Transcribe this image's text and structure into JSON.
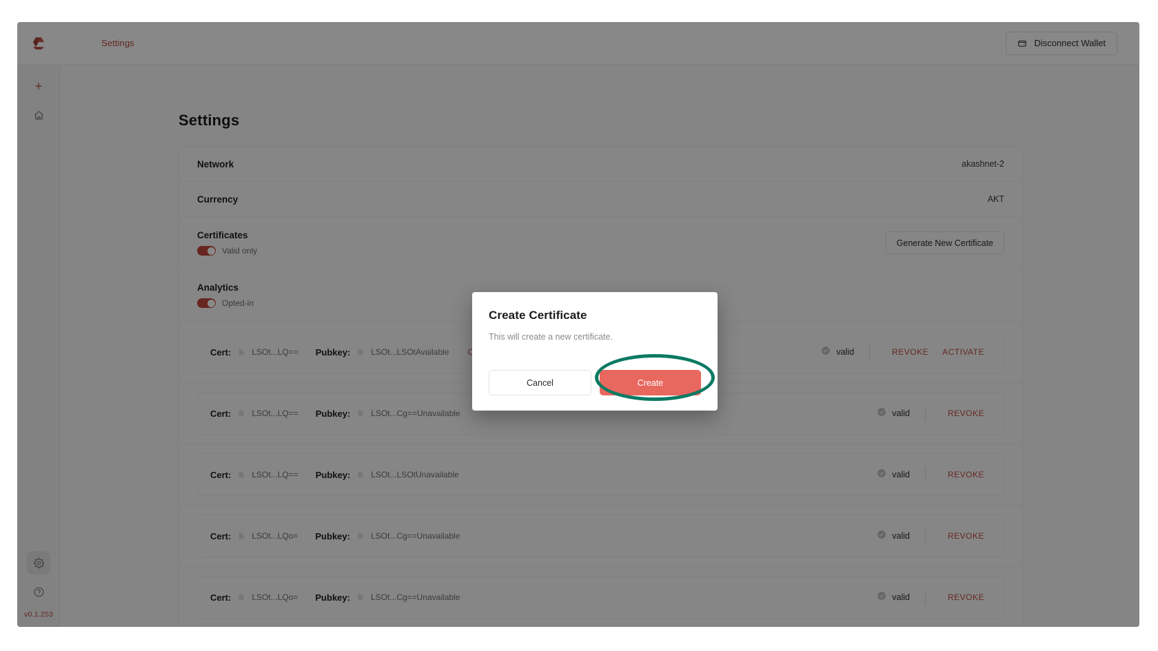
{
  "topbar": {
    "logo_icon": "akash-logo-icon",
    "nav_label": "Settings",
    "wallet_button_label": "Disconnect Wallet",
    "wallet_icon": "wallet-icon"
  },
  "rail": {
    "add_icon": "plus-icon",
    "home_icon": "home-icon",
    "settings_icon": "gear-icon",
    "help_icon": "question-circle-icon",
    "version": "v0.1.253"
  },
  "page": {
    "title": "Settings"
  },
  "settings": {
    "network": {
      "label": "Network",
      "value": "akashnet-2"
    },
    "currency": {
      "label": "Currency",
      "value": "AKT"
    },
    "certificates": {
      "label": "Certificates",
      "toggle_label": "Valid only",
      "toggle_on": true,
      "button_label": "Generate New Certificate"
    },
    "analytics": {
      "label": "Analytics",
      "toggle_label": "Opted-in",
      "toggle_on": true
    }
  },
  "cert_list": {
    "cert_key_label": "Cert:",
    "pubkey_label": "Pubkey:",
    "copy_icon": "copy-document-icon",
    "valid_icon": "check-circle-icon",
    "rows": [
      {
        "cert": "LSOt...LQ==",
        "pubkey": "LSOt...LSOtAvailable",
        "current": "Current",
        "status": "valid",
        "revoke": "REVOKE",
        "activate": "ACTIVATE"
      },
      {
        "cert": "LSOt...LQ==",
        "pubkey": "LSOt...Cg==Unavailable",
        "current": "",
        "status": "valid",
        "revoke": "REVOKE",
        "activate": ""
      },
      {
        "cert": "LSOt...LQ==",
        "pubkey": "LSOt...LSOtUnavailable",
        "current": "",
        "status": "valid",
        "revoke": "REVOKE",
        "activate": ""
      },
      {
        "cert": "LSOt...LQo=",
        "pubkey": "LSOt...Cg==Unavailable",
        "current": "",
        "status": "valid",
        "revoke": "REVOKE",
        "activate": ""
      },
      {
        "cert": "LSOt...LQo=",
        "pubkey": "LSOt...Cg==Unavailable",
        "current": "",
        "status": "valid",
        "revoke": "REVOKE",
        "activate": ""
      }
    ]
  },
  "modal": {
    "title": "Create Certificate",
    "description": "This will create a new certificate.",
    "cancel_label": "Cancel",
    "create_label": "Create"
  },
  "annotation": {
    "shape": "ellipse-highlight",
    "target": "create-button",
    "color": "#0b7a62"
  },
  "colors": {
    "brand_red": "#b3483f",
    "accent_red": "#e8675e",
    "toggle_on": "#c0453c",
    "annotation_teal": "#0b7a62"
  }
}
